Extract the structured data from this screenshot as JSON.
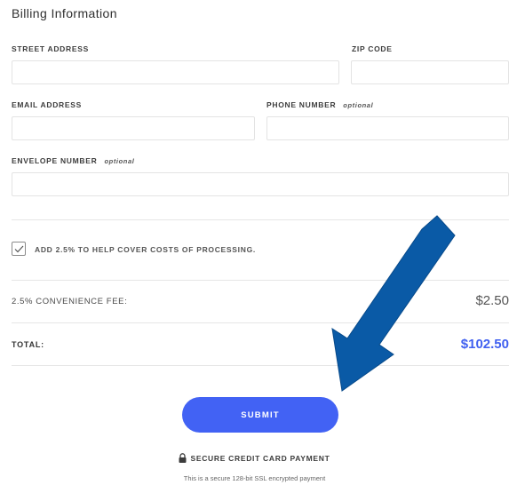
{
  "section": {
    "title": "Billing Information"
  },
  "fields": {
    "street_address": {
      "label": "STREET ADDRESS",
      "value": ""
    },
    "zip_code": {
      "label": "ZIP CODE",
      "value": ""
    },
    "email_address": {
      "label": "EMAIL ADDRESS",
      "value": ""
    },
    "phone_number": {
      "label": "PHONE NUMBER",
      "optional": "optional",
      "value": ""
    },
    "envelope_number": {
      "label": "ENVELOPE NUMBER",
      "optional": "optional",
      "value": ""
    }
  },
  "processing": {
    "checked": true,
    "label": "ADD 2.5% TO HELP COVER COSTS OF PROCESSING."
  },
  "summary": {
    "fee_label": "2.5% CONVENIENCE FEE:",
    "fee_value": "$2.50",
    "total_label": "TOTAL:",
    "total_value": "$102.50"
  },
  "actions": {
    "submit_label": "SUBMIT"
  },
  "security": {
    "badge_text": "SECURE CREDIT CARD PAYMENT",
    "badge_icon": "lock-icon",
    "note": "This is a secure 128-bit SSL encrypted payment"
  },
  "overlay": {
    "arrow_icon": "arrow-pointer-icon"
  },
  "colors": {
    "accent": "#4262f4",
    "total": "#4060f0",
    "arrow": "#0a5aa6",
    "border": "#e3e3e3"
  }
}
